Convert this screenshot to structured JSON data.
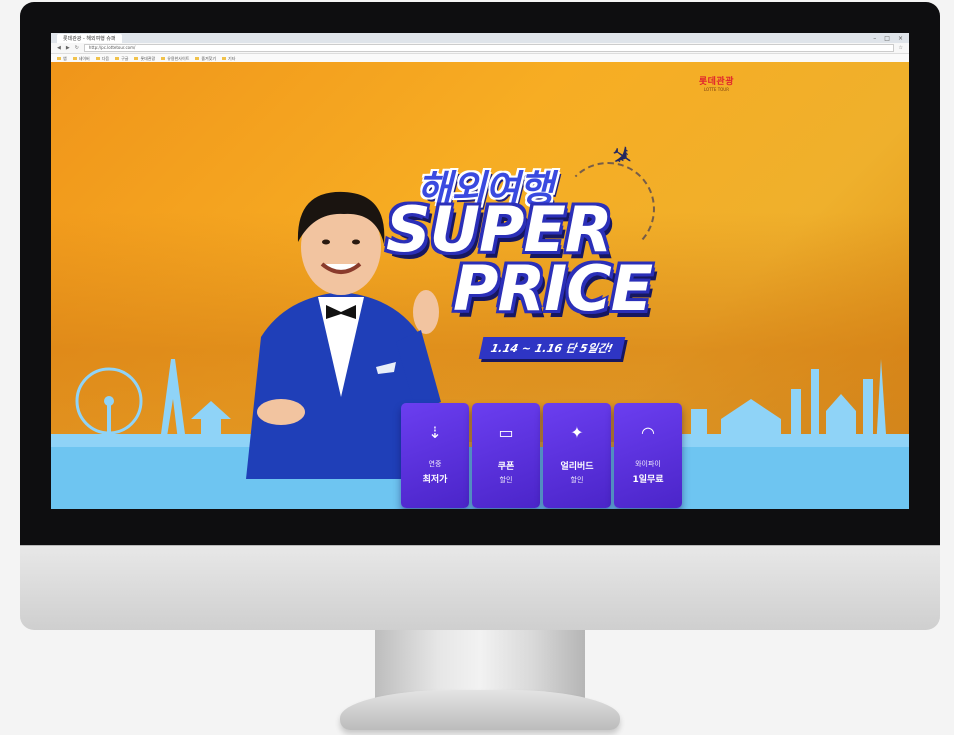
{
  "browser": {
    "tab_title": "롯데관광 - 해외여행 슈퍼",
    "url": "http://pc.lottetour.com/",
    "window_controls": [
      "–",
      "□",
      "×"
    ],
    "bookmarks": [
      "앱",
      "네이버",
      "다음",
      "구글",
      "롯데관광",
      "유용한사이트",
      "즐겨찾기",
      "기타"
    ]
  },
  "banner": {
    "logo_ko": "롯데관광",
    "logo_en": "LOTTE TOUR",
    "headline_ko": "해외여행",
    "headline_line1": "SUPER",
    "headline_line2": "PRICE",
    "date_range": "1.14 ~ 1.16 단 5일간!"
  },
  "cards": [
    {
      "icon": "arrow-down-icon",
      "line1": "연중",
      "line2": "최저가"
    },
    {
      "icon": "coupon-icon",
      "line1": "쿠폰",
      "line2": "할인"
    },
    {
      "icon": "bird-icon",
      "line1": "얼리버드",
      "line2": "할인"
    },
    {
      "icon": "wifi-icon",
      "line1": "와이파이",
      "line2": "1일무료"
    }
  ],
  "colors": {
    "banner_orange": "#f7ad23",
    "card_purple": "#5a30de",
    "band_blue": "#6ec5f1",
    "title_blue": "#2b2fb8"
  }
}
